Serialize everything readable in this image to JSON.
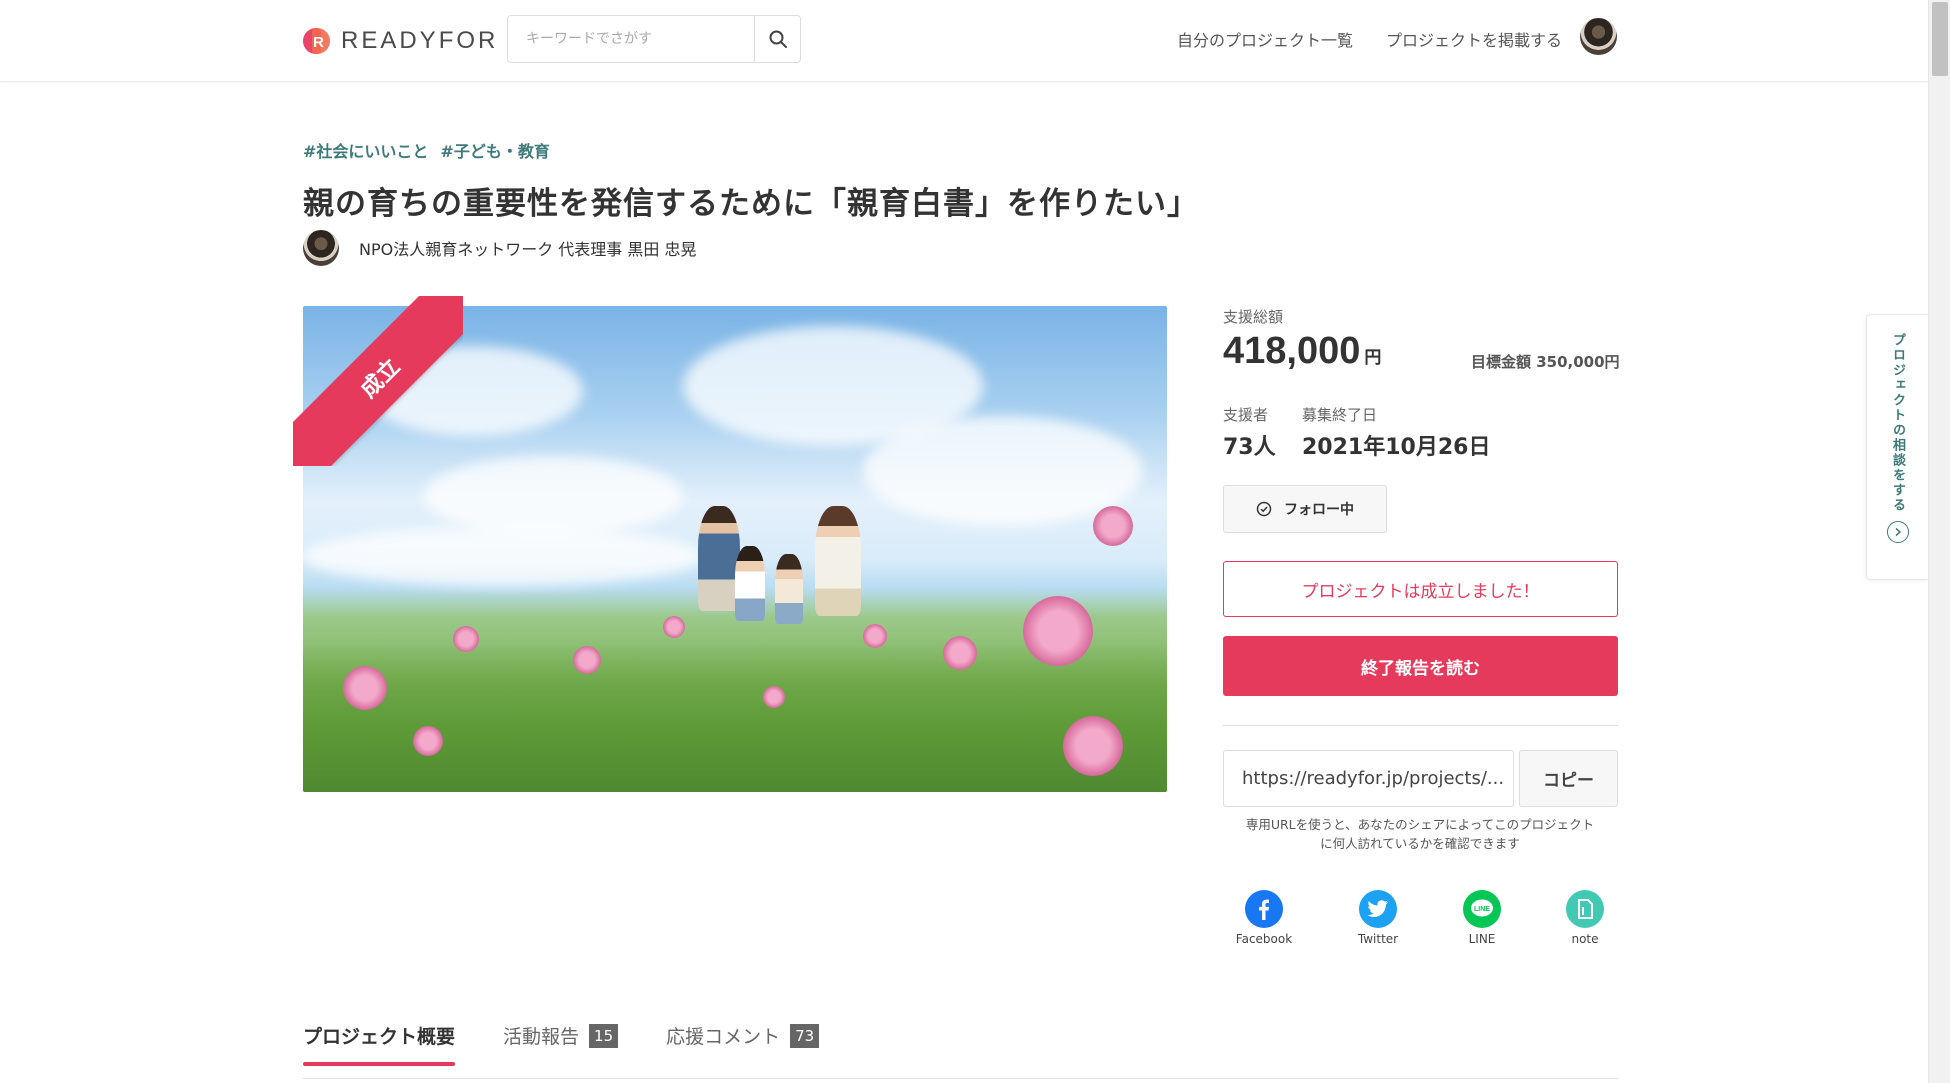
{
  "header": {
    "logo_text": "READYFOR",
    "search_placeholder": "キーワードでさがす",
    "nav_my_projects": "自分のプロジェクト一覧",
    "nav_post_project": "プロジェクトを掲載する"
  },
  "project": {
    "tags": [
      "#社会にいいこと",
      "#子ども・教育"
    ],
    "title": "親の育ちの重要性を発信するために「親育白書」を作りたい」",
    "owner": "NPO法人親育ネットワーク 代表理事 黒田 忠晃",
    "ribbon": "成立"
  },
  "stats": {
    "total_label": "支援総額",
    "total_amount": "418,000",
    "yen": "円",
    "goal": "目標金額 350,000円",
    "backers_label": "支援者",
    "backers": "73人",
    "end_label": "募集終了日",
    "end_date": "2021年10月26日"
  },
  "actions": {
    "follow": "フォロー中",
    "success_message": "プロジェクトは成立しました！",
    "report_button": "終了報告を読む",
    "url": "https://readyfor.jp/projects/...",
    "copy": "コピー",
    "url_note": "専用URLを使うと、あなたのシェアによってこのプロジェクトに何人訪れているかを確認できます"
  },
  "share": [
    {
      "label": "Facebook",
      "icon": "facebook-icon",
      "color": "#1877f2"
    },
    {
      "label": "Twitter",
      "icon": "twitter-icon",
      "color": "#1da1f2"
    },
    {
      "label": "LINE",
      "icon": "line-icon",
      "color": "#06c755"
    },
    {
      "label": "note",
      "icon": "note-icon",
      "color": "#41c9b4"
    }
  ],
  "tabs": [
    {
      "label": "プロジェクト概要",
      "count": null,
      "active": true
    },
    {
      "label": "活動報告",
      "count": "15",
      "active": false
    },
    {
      "label": "応援コメント",
      "count": "73",
      "active": false
    }
  ],
  "side_panel": {
    "label": "プロジェクトの相談をする"
  },
  "colors": {
    "accent": "#e53a5b",
    "tag": "#3e7a7a"
  }
}
